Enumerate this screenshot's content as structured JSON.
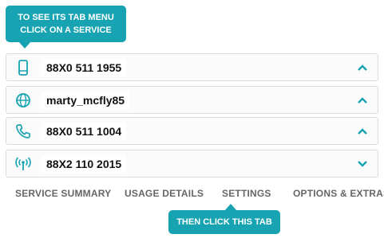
{
  "callouts": {
    "top_line1": "TO SEE ITS TAB MENU",
    "top_line2": "CLICK ON A SERVICE",
    "bottom": "THEN CLICK THIS TAB"
  },
  "services": [
    {
      "icon": "mobile-phone-icon",
      "number": "88X0 511 1955",
      "chevron": "up"
    },
    {
      "icon": "globe-icon",
      "number": "marty_mcfly85",
      "chevron": "up"
    },
    {
      "icon": "phone-handset-icon",
      "number": "88X0 511 1004",
      "chevron": "up"
    },
    {
      "icon": "wireless-signal-icon",
      "number": "88X2 110 2015",
      "chevron": "down"
    }
  ],
  "tabs": [
    "SERVICE SUMMARY",
    "USAGE DETAILS",
    "SETTINGS",
    "OPTIONS & EXTRAS"
  ],
  "colors": {
    "accent": "#17a3b1",
    "tab_text": "#666666",
    "row_border": "#dcdcdc"
  }
}
